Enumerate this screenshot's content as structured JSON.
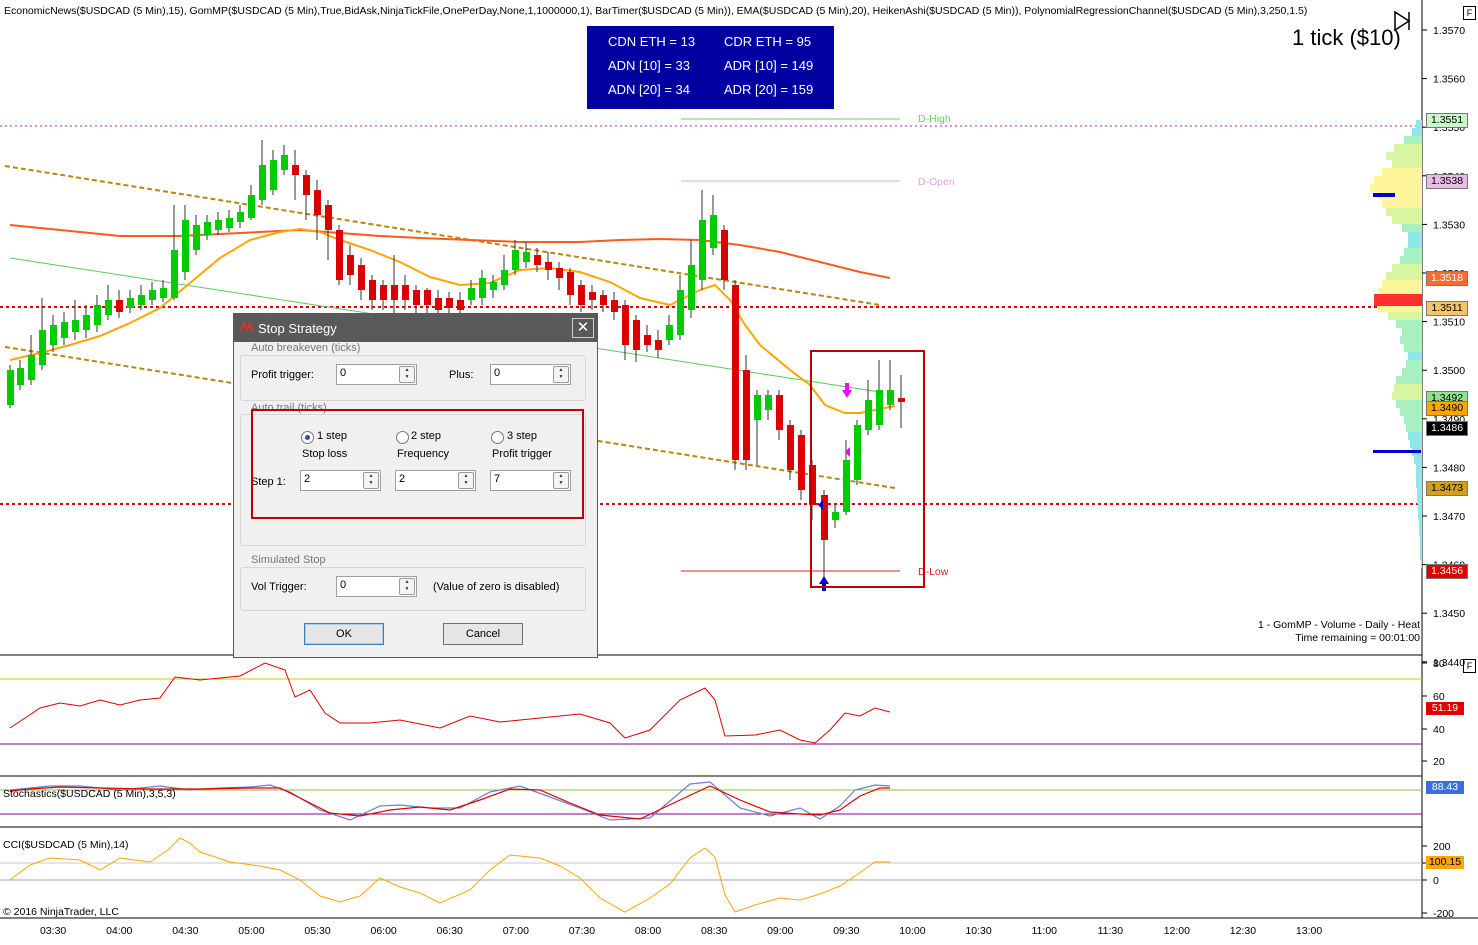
{
  "chart_header": {
    "indicators": "EconomicNews($USDCAD (5 Min),15), GomMP($USDCAD (5 Min),True,BidAsk,NinjaTickFile,OnePerDay,None,1,1000000,1), BarTimer($USDCAD (5 Min)), EMA($USDCAD (5 Min),20), HeikenAshi($USDCAD (5 Min)), PolynomialRegressionChannel($USDCAD (5 Min),3,250,1.5)",
    "tick_info": "1 tick ($10)"
  },
  "stats_box": {
    "cdn_eth": "CDN ETH = 13",
    "cdr_eth": "CDR ETH = 95",
    "adn_10": "ADN [10] = 33",
    "adr_10": "ADR [10] = 149",
    "adn_20": "ADN [20] = 34",
    "adr_20": "ADR [20] = 159"
  },
  "levels": {
    "d_high": "D-High",
    "d_open": "D-Open",
    "d_low": "D-Low"
  },
  "price_axis": {
    "ticks": [
      "1.3570",
      "1.3560",
      "1.3550",
      "1.3540",
      "1.3530",
      "1.3520",
      "1.3510",
      "1.3500",
      "1.3490",
      "1.3480",
      "1.3470",
      "1.3460",
      "1.3450",
      "1.3440"
    ],
    "tags": [
      {
        "label": "1.3551",
        "color": "#c8f7c8"
      },
      {
        "label": "1.3538",
        "color": "#e5bde5"
      },
      {
        "label": "1.3518",
        "color": "#ff6a30"
      },
      {
        "label": "1.3511",
        "color": "#f7c36a"
      },
      {
        "label": "1.3492",
        "color": "#8de28d"
      },
      {
        "label": "1.3490",
        "color": "#ffa500"
      },
      {
        "label": "1.3486",
        "color": "#000000"
      },
      {
        "label": "1.3473",
        "color": "#d4a017"
      },
      {
        "label": "1.3456",
        "color": "#e00000"
      }
    ]
  },
  "volume_profile_caption": {
    "line1": "1 - GomMP - Volume - Daily - Heat",
    "line2": "Time remaining = 00:01:00"
  },
  "panels": {
    "rsi": {
      "ticks": [
        "80",
        "60",
        "40",
        "20"
      ],
      "value": "51.19",
      "value_color": "#e00000"
    },
    "stochastics": {
      "label": "Stochastics($USDCAD (5 Min),3,5,3)",
      "value": "88.43",
      "value_color": "#3b6fe0"
    },
    "cci": {
      "label": "CCI($USDCAD (5 Min),14)",
      "ticks": [
        "200",
        "100",
        "0",
        "-200"
      ],
      "value": "100.15",
      "value_color": "#ffa500"
    }
  },
  "time_axis": [
    "03:30",
    "04:00",
    "04:30",
    "05:00",
    "05:30",
    "06:00",
    "06:30",
    "07:00",
    "07:30",
    "08:00",
    "08:30",
    "09:00",
    "09:30",
    "10:00",
    "10:30",
    "11:00",
    "11:30",
    "12:00",
    "12:30",
    "13:00"
  ],
  "copyright": "© 2016 NinjaTrader, LLC",
  "dialog": {
    "title": "Stop Strategy",
    "close": "✕",
    "auto_breakeven": {
      "title": "Auto breakeven (ticks)",
      "profit_trigger_label": "Profit trigger:",
      "profit_trigger_value": "0",
      "plus_label": "Plus:",
      "plus_value": "0"
    },
    "auto_trail": {
      "title": "Auto trail (ticks)",
      "options": [
        "1 step",
        "2 step",
        "3 step"
      ],
      "selected": "1 step",
      "col_labels": [
        "Stop loss",
        "Frequency",
        "Profit trigger"
      ],
      "step1_label": "Step 1:",
      "step1_values": [
        "2",
        "2",
        "7"
      ]
    },
    "simulated_stop": {
      "title": "Simulated Stop",
      "vol_trigger_label": "Vol Trigger:",
      "vol_trigger_value": "0",
      "note": "(Value of zero is disabled)"
    },
    "ok": "OK",
    "cancel": "Cancel"
  },
  "colors": {
    "bull": "#00cc00",
    "bear": "#dd0000",
    "ema": "#ffa500",
    "sma": "#ff5a1e",
    "channel": "#b8860b",
    "highlight": "#c00000"
  }
}
